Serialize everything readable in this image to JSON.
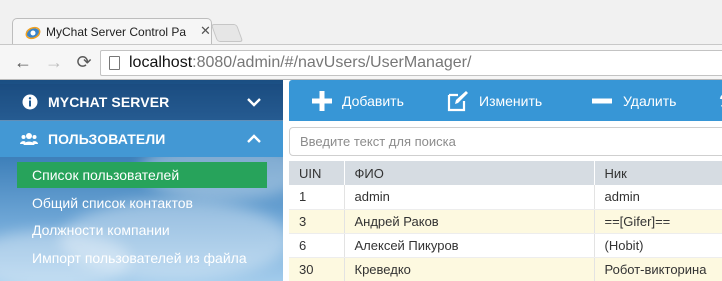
{
  "browser": {
    "tab_title": "MyChat Server Control Pa",
    "url_host": "localhost",
    "url_path": ":8080/admin/#/navUsers/UserManager/"
  },
  "sidebar": {
    "sections": [
      {
        "label": "MYCHAT SERVER",
        "icon": "info-icon",
        "state": "collapsed"
      },
      {
        "label": "ПОЛЬЗОВАТЕЛИ",
        "icon": "users-icon",
        "state": "expanded"
      }
    ],
    "items": [
      {
        "label": "Список пользователей",
        "active": true
      },
      {
        "label": "Общий список контактов",
        "active": false
      },
      {
        "label": "Должности компании",
        "active": false
      },
      {
        "label": "Импорт пользователей из файла",
        "active": false
      }
    ]
  },
  "toolbar": {
    "add_label": "Добавить",
    "edit_label": "Изменить",
    "delete_label": "Удалить"
  },
  "search": {
    "placeholder": "Введите текст для поиска",
    "value": ""
  },
  "table": {
    "columns": [
      "UIN",
      "ФИО",
      "Ник"
    ],
    "rows": [
      [
        "1",
        "admin",
        "admin"
      ],
      [
        "3",
        "Андрей Раков",
        "==[Gifer]=="
      ],
      [
        "6",
        "Алексей Пикуров",
        "(Hobit)"
      ],
      [
        "30",
        "Креведко",
        "Робот-викторина"
      ]
    ]
  },
  "colors": {
    "toolbar_bg": "#3796d6",
    "active_item": "#27a35b",
    "section_header": "#4398d4",
    "row_alt": "#fdf9e0",
    "table_header": "#d6dce2"
  }
}
